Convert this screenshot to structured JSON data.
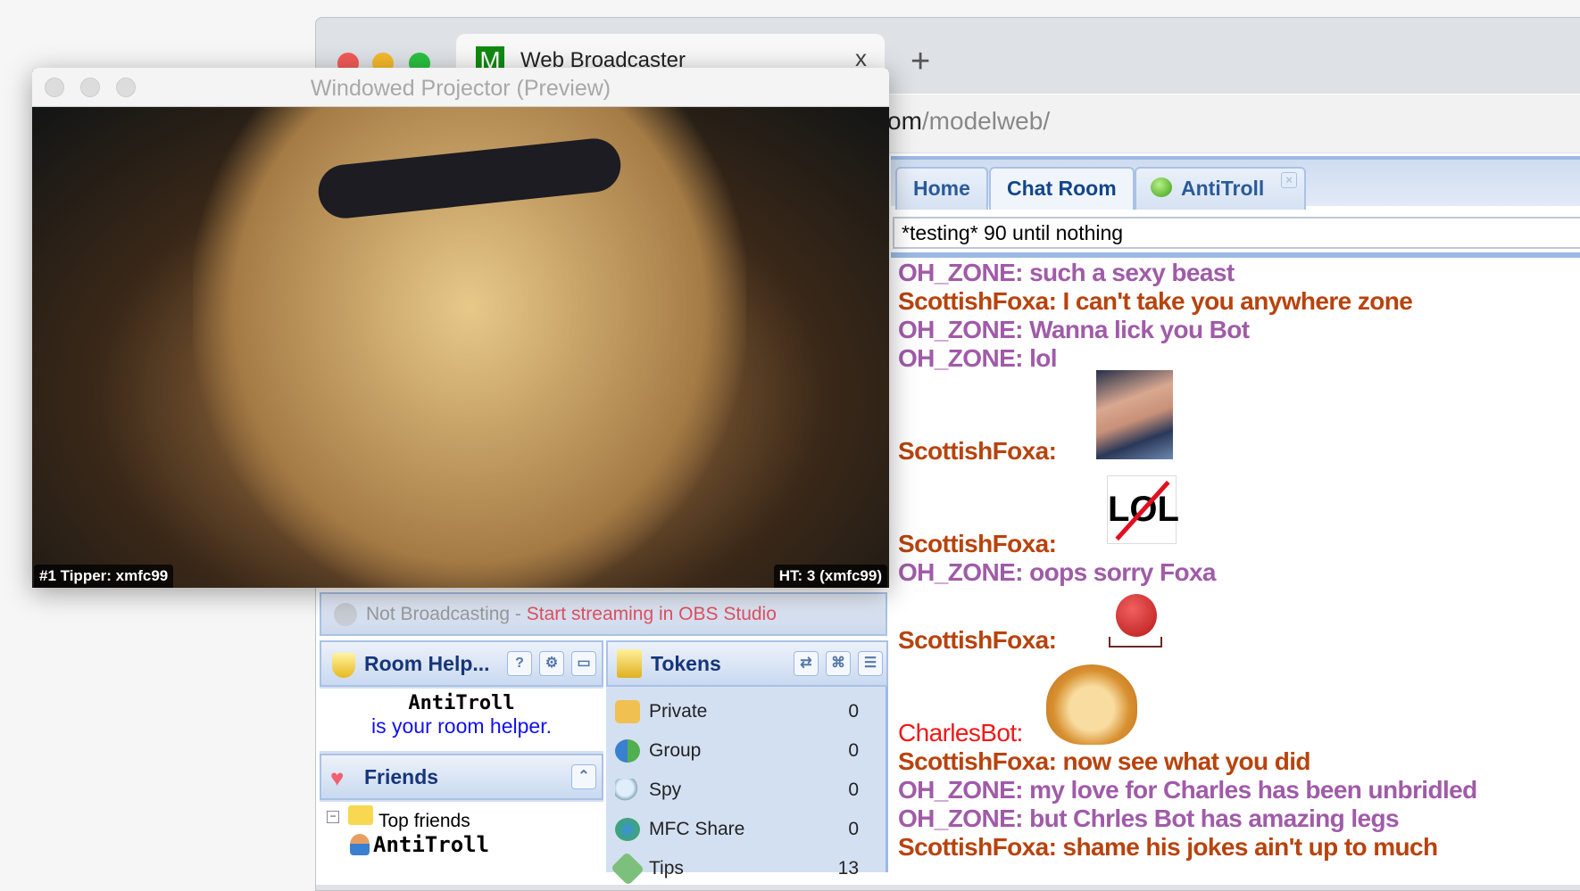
{
  "browser": {
    "tab_title": "Web Broadcaster",
    "tab_favicon": "M",
    "tab_close": "x",
    "new_tab": "+",
    "url_visible_host_end": "om",
    "url_path": "/modelweb/"
  },
  "projector": {
    "title": "Windowed Projector (Preview)",
    "overlay_left": "#1 Tipper: xmfc99",
    "overlay_right": "HT: 3 (xmfc99)"
  },
  "chat_tabs": [
    {
      "label": "Home",
      "active": false
    },
    {
      "label": "Chat Room",
      "active": true
    },
    {
      "label": "AntiTroll",
      "active": false,
      "closable": true
    }
  ],
  "topic": "*testing* 90 until nothing",
  "messages": [
    {
      "user": "OH_ZONE",
      "text": " such a sexy beast",
      "color": "#a05ba8"
    },
    {
      "user": "ScottishFoxa",
      "text": " I can't take you anywhere zone",
      "color": "#b8430c"
    },
    {
      "user": "OH_ZONE",
      "text": " Wanna lick you Bot",
      "color": "#a05ba8"
    },
    {
      "user": "OH_ZONE",
      "text": " lol",
      "color": "#a05ba8"
    },
    {
      "user": "ScottishFoxa",
      "text": "",
      "emote": "photo-emote"
    },
    {
      "user": "ScottishFoxa",
      "text": "",
      "emote": "no-lol-emote"
    },
    {
      "user": "OH_ZONE",
      "text": " oops sorry Foxa",
      "color": "#a05ba8"
    },
    {
      "user": "ScottishFoxa",
      "text": "",
      "emote": "angry-red-ball-emote"
    },
    {
      "user": "CharlesBot",
      "text": "",
      "emote": "crying-monkey-emote",
      "color": "#f01818"
    },
    {
      "user": "ScottishFoxa",
      "text": " now see what you did",
      "color": "#b8430c"
    },
    {
      "user": "OH_ZONE",
      "text": " my love for Charles has been unbridled",
      "color": "#a05ba8"
    },
    {
      "user": "OH_ZONE",
      "text": " but Chrles Bot has amazing legs",
      "color": "#a05ba8"
    },
    {
      "user": "ScottishFoxa",
      "text": " shame his jokes ain't up to much",
      "color": "#b8430c"
    }
  ],
  "status": {
    "state": "Not Broadcasting",
    "separator": " - ",
    "action": "Start streaming in OBS Studio"
  },
  "room_helper": {
    "title": "Room Help...",
    "name": "AntiTroll",
    "text": "is your room helper.",
    "buttons": [
      "help-icon",
      "settings-icon",
      "save-icon"
    ]
  },
  "friends": {
    "title": "Friends",
    "group": "Top friends",
    "items": [
      "AntiTroll"
    ]
  },
  "tokens": {
    "title": "Tokens",
    "rows": [
      {
        "label": "Private",
        "value": "0",
        "icon": "lock-icon"
      },
      {
        "label": "Group",
        "value": "0",
        "icon": "group-icon"
      },
      {
        "label": "Spy",
        "value": "0",
        "icon": "magnifier-icon"
      },
      {
        "label": "MFC Share",
        "value": "0",
        "icon": "globe-icon"
      },
      {
        "label": "Tips",
        "value": "13",
        "icon": "money-icon"
      }
    ]
  }
}
